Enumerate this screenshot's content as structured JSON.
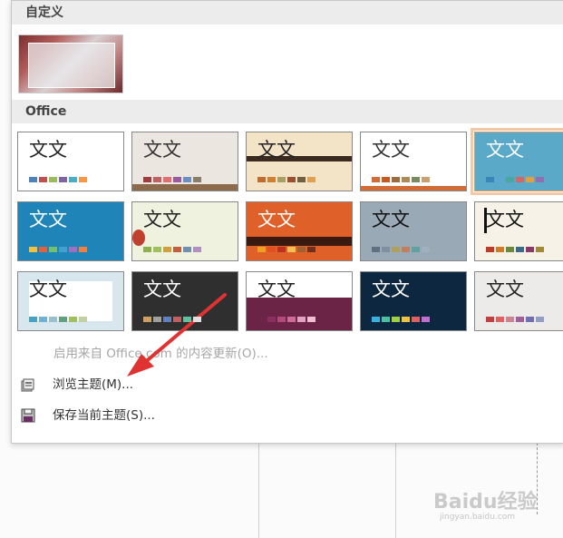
{
  "sections": {
    "custom_label": "自定义",
    "office_label": "Office"
  },
  "theme_text": "文文",
  "themes": [
    {
      "bg": "#ffffff",
      "text": "#222222",
      "swatches": [
        "#4f81bd",
        "#c0504d",
        "#9bbb59",
        "#8064a2",
        "#4bacc6",
        "#f79646"
      ]
    },
    {
      "bg": "#ece6e0",
      "text": "#333333",
      "swatches": [
        "#a03c3c",
        "#c06060",
        "#e07070",
        "#9a5aa0",
        "#6b8fc3",
        "#8b7d6b"
      ]
    },
    {
      "bg": "#f3e4c8",
      "text": "#222222",
      "swatches": [
        "#c06c2c",
        "#d08030",
        "#a8a060",
        "#9c5030",
        "#706040",
        "#e0a050"
      ]
    },
    {
      "bg": "#ffffff",
      "text": "#333333",
      "swatches": [
        "#d26c36",
        "#c85a20",
        "#9c6b40",
        "#b08a54",
        "#7a8a60",
        "#caa070"
      ]
    },
    {
      "bg": "#5aa9c8",
      "text": "#ffffff",
      "swatches": [
        "#3b86b8",
        "#5ca8d0",
        "#4aa6a0",
        "#d06868",
        "#e0a040",
        "#9070b0"
      ]
    },
    {
      "bg": "#1f84b8",
      "text": "#ffffff",
      "swatches": [
        "#f0c040",
        "#e06040",
        "#70c070",
        "#40a0d0",
        "#a070c0",
        "#f08040"
      ]
    },
    {
      "bg": "#eef2df",
      "text": "#222222",
      "swatches": [
        "#8cb04c",
        "#a0c060",
        "#d0a040",
        "#c06040",
        "#7090b0",
        "#b090c0"
      ]
    },
    {
      "bg": "#e0602a",
      "text": "#ffffff",
      "swatches": [
        "#f0a020",
        "#e05020",
        "#c03020",
        "#f0c050",
        "#a06030",
        "#703020"
      ]
    },
    {
      "bg": "#9aa9b6",
      "text": "#111111",
      "swatches": [
        "#607080",
        "#8090a0",
        "#b0a060",
        "#c08060",
        "#60a0a0",
        "#a0b0c0"
      ]
    },
    {
      "bg": "#f6f2e8",
      "text": "#111111",
      "swatches": [
        "#c03a2a",
        "#d07a2a",
        "#6a8a3a",
        "#3a6a8a",
        "#8a3a6a",
        "#a08a3a"
      ]
    },
    {
      "bg": "#d8e6ee",
      "text": "#222222",
      "swatches": [
        "#4aa0c0",
        "#70b0d0",
        "#9ac0d0",
        "#60a080",
        "#a0c060",
        "#c0d0a0"
      ]
    },
    {
      "bg": "#2f2f2f",
      "text": "#ffffff",
      "swatches": [
        "#d0a060",
        "#a0a0a0",
        "#6080c0",
        "#c06060",
        "#60c0a0",
        "#e0e0e0"
      ]
    },
    {
      "bg": "#ffffff",
      "text": "#222222",
      "swatches": [
        "#6b2346",
        "#8a3060",
        "#b04a7a",
        "#d06a9a",
        "#e0a0c0",
        "#f0c0d0"
      ]
    },
    {
      "bg": "#0d2740",
      "text": "#ffffff",
      "swatches": [
        "#3ab0e0",
        "#4ac0a0",
        "#a0d040",
        "#f0c040",
        "#e06060",
        "#c070d0"
      ]
    },
    {
      "bg": "#ecebea",
      "text": "#222222",
      "swatches": [
        "#c04040",
        "#e06060",
        "#d08090",
        "#a060a0",
        "#7070b0",
        "#90a0c0"
      ]
    }
  ],
  "menu": {
    "update_label": "启用来自 Office.com 的内容更新(O)...",
    "browse_label": "浏览主题(M)...",
    "save_label": "保存当前主题(S)..."
  },
  "watermark": {
    "text": "Baidu经验",
    "sub": "jingyan.baidu.com"
  },
  "colors": {
    "arrow": "#e03232",
    "selected_border": "#f2c8a6"
  }
}
